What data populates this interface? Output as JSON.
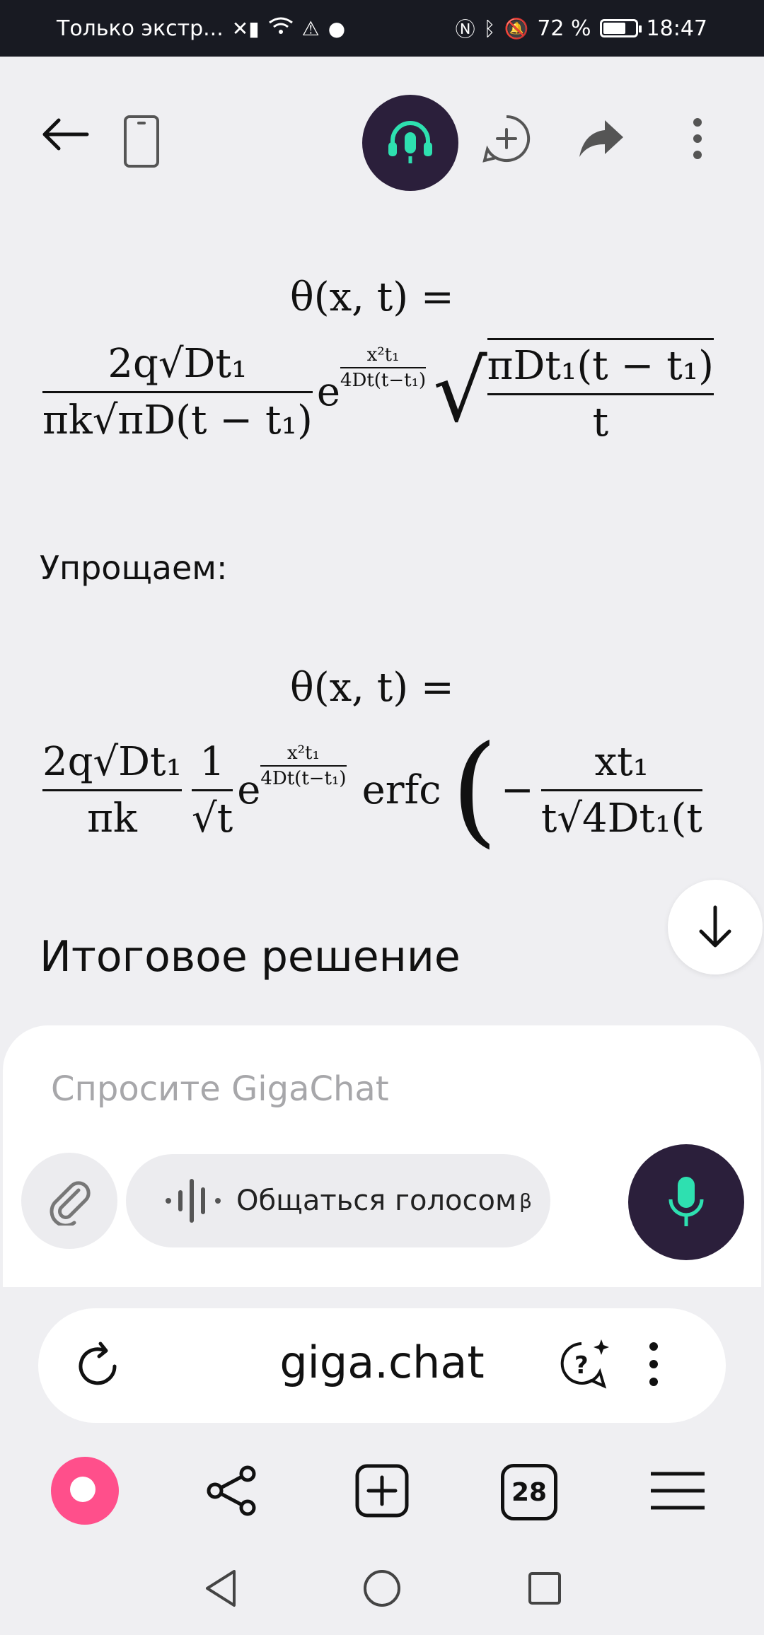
{
  "status_bar": {
    "carrier": "Только экстр...",
    "battery_percent": "72 %",
    "battery_level": 0.72,
    "time": "18:47"
  },
  "toolbar": {
    "icons": [
      "back-arrow-icon",
      "device-icon",
      "headset-mic-icon",
      "new-chat-icon",
      "share-icon",
      "more-vertical-icon"
    ],
    "accent": "#2b1f3b",
    "mint": "#2ee0b0"
  },
  "content": {
    "eq1_lhs": "θ(x, t) =",
    "eq1_num1": "2q√Dt₁",
    "eq1_den1": "πk√πD(t − t₁)",
    "eq1_exp_num": "x²t₁",
    "eq1_exp_den": "4Dt(t−t₁)",
    "eq1_sqrt_num": "πDt₁(t − t₁)",
    "eq1_sqrt_den": "t",
    "simplify_label": "Упрощаем:",
    "eq2_lhs": "θ(x, t) =",
    "eq2_num1": "2q√Dt₁",
    "eq2_den1": "πk",
    "eq2_num2": "1",
    "eq2_den2": "√t",
    "eq2_exp_num": "x²t₁",
    "eq2_exp_den": "4Dt(t−t₁)",
    "eq2_erfc": "erfc",
    "eq2_num3": "xt₁",
    "eq2_den3": "t√4Dt₁(t",
    "heading": "Итоговое решение"
  },
  "input": {
    "placeholder": "Спросите GigaChat",
    "voice_label": "Общаться голосом",
    "voice_beta": "β"
  },
  "browser": {
    "url": "giga.chat",
    "tabs_count": "28"
  }
}
